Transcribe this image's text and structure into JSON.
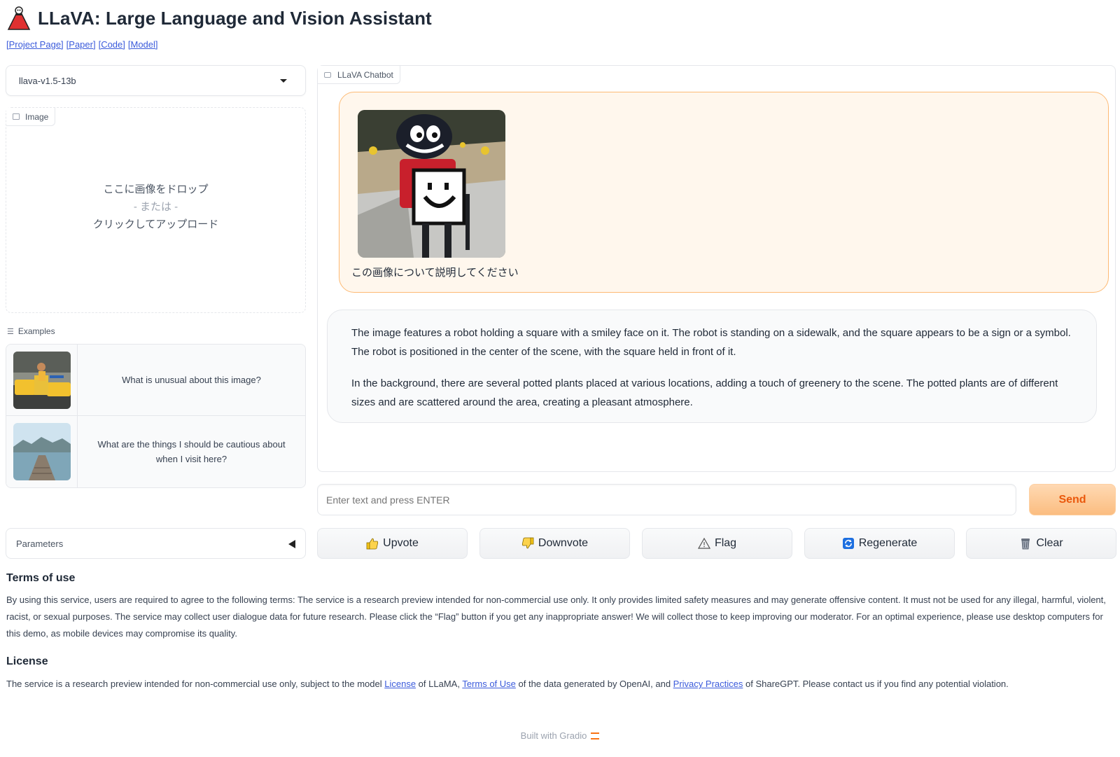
{
  "app": {
    "title": "LLaVA: Large Language and Vision Assistant",
    "links": [
      "[Project Page]",
      "[Paper]",
      "[Code]",
      "[Model]"
    ]
  },
  "model_select": {
    "value": "llava-v1.5-13b"
  },
  "image_upload": {
    "label": "Image",
    "drop_line1": "ここに画像をドロップ",
    "drop_line2": "- または -",
    "drop_line3": "クリックしてアップロード"
  },
  "examples": {
    "label": "Examples",
    "items": [
      {
        "text": "What is unusual about this image?"
      },
      {
        "text": "What are the things I should be cautious about when I visit here?"
      }
    ]
  },
  "parameters": {
    "label": "Parameters"
  },
  "chatbot": {
    "label": "LLaVA Chatbot",
    "user_message": "この画像について説明してください",
    "bot_paragraphs": [
      "The image features a robot holding a square with a smiley face on it. The robot is standing on a sidewalk, and the square appears to be a sign or a symbol. The robot is positioned in the center of the scene, with the square held in front of it.",
      "In the background, there are several potted plants placed at various locations, adding a touch of greenery to the scene. The potted plants are of different sizes and are scattered around the area, creating a pleasant atmosphere."
    ]
  },
  "input": {
    "placeholder": "Enter text and press ENTER",
    "value": ""
  },
  "buttons": {
    "send": "Send",
    "upvote": "Upvote",
    "downvote": "Downvote",
    "flag": "Flag",
    "regenerate": "Regenerate",
    "clear": "Clear"
  },
  "terms": {
    "heading": "Terms of use",
    "text": "By using this service, users are required to agree to the following terms: The service is a research preview intended for non-commercial use only. It only provides limited safety measures and may generate offensive content. It must not be used for any illegal, harmful, violent, racist, or sexual purposes. The service may collect user dialogue data for future research. Please click the “Flag” button if you get any inappropriate answer! We will collect those to keep improving our moderator. For an optimal experience, please use desktop computers for this demo, as mobile devices may compromise its quality."
  },
  "license": {
    "heading": "License",
    "t1": "The service is a research preview intended for non-commercial use only, subject to the model ",
    "link1": "License",
    "t2": " of LLaMA, ",
    "link2": "Terms of Use",
    "t3": " of the data generated by OpenAI, and ",
    "link3": "Privacy Practices",
    "t4": " of ShareGPT. Please contact us if you find any potential violation."
  },
  "footer": {
    "text": "Built with Gradio"
  },
  "colors": {
    "accent": "#f97316",
    "send_bg": "#fbbd80",
    "user_bubble": "#fff7ed",
    "link": "#3b5bdb"
  }
}
